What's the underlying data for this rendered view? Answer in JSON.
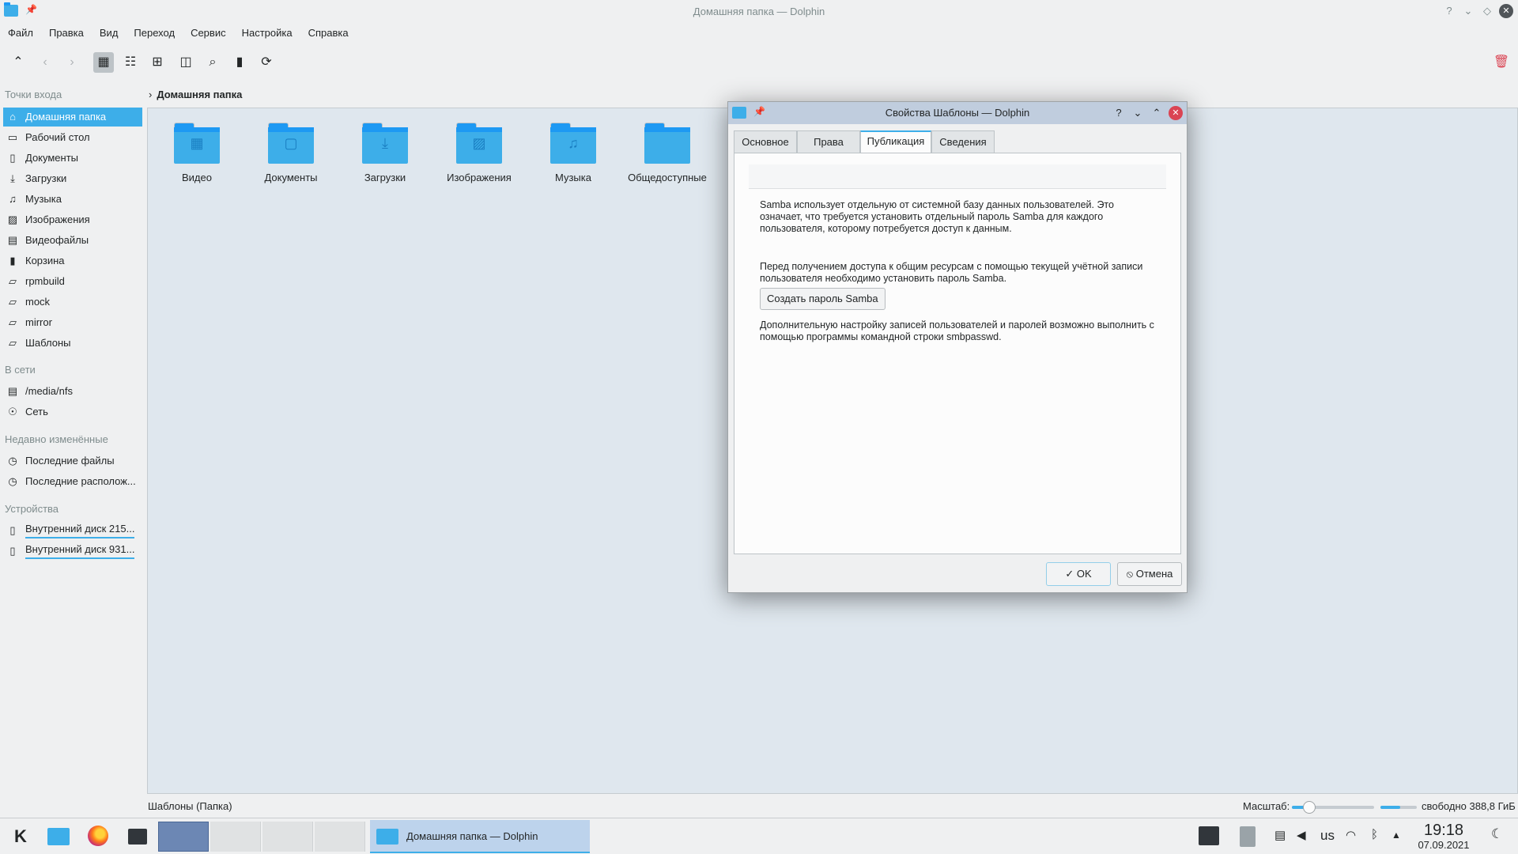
{
  "window": {
    "title": "Домашняя папка — Dolphin",
    "pin": "📌",
    "controls": {
      "help": "?",
      "minimize": "⌄",
      "maximize": "◇",
      "close": "✕"
    }
  },
  "menu": [
    "Файл",
    "Правка",
    "Вид",
    "Переход",
    "Сервис",
    "Настройка",
    "Справка"
  ],
  "toolbar": {
    "up": "⌃",
    "back": "‹",
    "forward": "›",
    "icons_view": "▦",
    "compact_view": "☷",
    "details_view": "⊞",
    "split": "◫",
    "search": "⌕",
    "terminal": "▮",
    "refresh": "⟳",
    "trash": "🗑"
  },
  "sidebar": {
    "sections": {
      "places": "Точки входа",
      "network": "В сети",
      "recent": "Недавно изменённые",
      "devices": "Устройства"
    },
    "places": [
      {
        "label": "Домашняя папка",
        "icon": "⌂"
      },
      {
        "label": "Рабочий стол",
        "icon": "▭"
      },
      {
        "label": "Документы",
        "icon": "▯"
      },
      {
        "label": "Загрузки",
        "icon": "⤓"
      },
      {
        "label": "Музыка",
        "icon": "♫"
      },
      {
        "label": "Изображения",
        "icon": "▨"
      },
      {
        "label": "Видеофайлы",
        "icon": "▤"
      },
      {
        "label": "Корзина",
        "icon": "▮"
      },
      {
        "label": "rpmbuild",
        "icon": "▱"
      },
      {
        "label": "mock",
        "icon": "▱"
      },
      {
        "label": "mirror",
        "icon": "▱"
      },
      {
        "label": "Шаблоны",
        "icon": "▱"
      }
    ],
    "network": [
      {
        "label": "/media/nfs",
        "icon": "▤"
      },
      {
        "label": "Сеть",
        "icon": "☉"
      }
    ],
    "recent": [
      {
        "label": "Последние файлы",
        "icon": "◷"
      },
      {
        "label": "Последние располож...",
        "icon": "◷"
      }
    ],
    "devices": [
      {
        "label": "Внутренний диск 215...",
        "icon": "▯"
      },
      {
        "label": "Внутренний диск 931...",
        "icon": "▯"
      }
    ]
  },
  "breadcrumb": {
    "chevron": "›",
    "current": "Домашняя папка"
  },
  "folders": [
    {
      "name": "Видео",
      "emblem": "▦"
    },
    {
      "name": "Документы",
      "emblem": "▢"
    },
    {
      "name": "Загрузки",
      "emblem": "⤓"
    },
    {
      "name": "Изображения",
      "emblem": "▨"
    },
    {
      "name": "Музыка",
      "emblem": "♫"
    },
    {
      "name": "Общедоступные",
      "emblem": ""
    }
  ],
  "statusbar": {
    "selection": "Шаблоны (Папка)",
    "zoom_label": "Масштаб:",
    "zoom_level": 0.2,
    "space_used_fraction": 0.55,
    "free_space": "свободно 388,8 ГиБ"
  },
  "dialog": {
    "title": "Свойства Шаблоны — Dolphin",
    "controls": {
      "help": "?",
      "minimize": "⌄",
      "maximize": "⌃",
      "close": "✕"
    },
    "tabs": [
      "Основное",
      "Права",
      "Публикация",
      "Сведения"
    ],
    "active_tab": 2,
    "para1": "Samba использует отдельную от системной базу данных пользователей. Это означает, что требуется установить отдельный пароль Samba для каждого пользователя, которому потребуется доступ к данным.",
    "para2": "Перед получением доступа к общим ресурсам с помощью текущей учётной записи пользователя необходимо установить пароль Samba.",
    "create_button": "Создать пароль Samba",
    "para3": "Дополнительную настройку записей пользователей и паролей возможно выполнить с помощью программы командной строки smbpasswd.",
    "ok": "✓ OK",
    "cancel": "⦸ Отмена"
  },
  "taskbar": {
    "launcher": "K",
    "task_title": "Домашняя папка — Dolphin",
    "tray": {
      "layout": "us",
      "time": "19:18",
      "date": "07.09.2021"
    }
  }
}
